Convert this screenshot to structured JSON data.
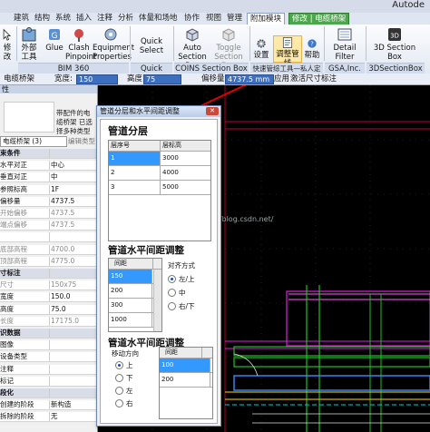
{
  "app_title": "Autode",
  "ribbon_tabs": [
    "建筑",
    "结构",
    "系统",
    "插入",
    "注释",
    "分析",
    "体量和场地",
    "协作",
    "视图",
    "管理",
    "附加模块",
    "修改 | 电缆桥架"
  ],
  "ribbon": {
    "modify": "修改",
    "external_tools": "外部工具",
    "glue": "Glue",
    "clash_pinpoint": "Clash Pinpoint",
    "equipment_properties": "Equipment Properties",
    "bim360_label": "BIM 360",
    "quick_select_1": "Quick Select",
    "quick_select_2": "Quick Select",
    "auto_section_box": "Auto Section Box",
    "toggle_section_box": "Toggle Section Box",
    "coins_label": "COINS Section Box",
    "settings": "设置",
    "pipe_adjust": "调整管线",
    "help": "帮助",
    "plugin_label": "快速管综工具—私人定制",
    "detail_filter": "Detail Filter",
    "gsa_label": "GSA,Inc.",
    "section_box_3d": "3D Section Box",
    "section_box_3d_label": "3DSectionBox"
  },
  "options_bar": {
    "tray_label": "电缆桥架",
    "width_label": "宽度:",
    "width_value": "150",
    "height_label": "高度:",
    "height_value": "75",
    "offset_label": "偏移量:",
    "offset_value": "4737.5 mm",
    "apply_label": "应用",
    "dim_label": "激活尺寸标注"
  },
  "properties": {
    "panel_title": "性",
    "type_desc": "带配件的电缆桥架 已选择多种类型",
    "type_select": "电缆桥架 (3)",
    "edit_type": "编辑类型",
    "rows": [
      {
        "k": "束条件",
        "v": "",
        "hdr": true
      },
      {
        "k": "水平对正",
        "v": "中心"
      },
      {
        "k": "垂直对正",
        "v": "中"
      },
      {
        "k": "参照标高",
        "v": "1F"
      },
      {
        "k": "偏移量",
        "v": "4737.5"
      },
      {
        "k": "开始偏移",
        "v": "4737.5",
        "dim": true
      },
      {
        "k": "端点偏移",
        "v": "4737.5",
        "dim": true
      },
      {
        "k": "",
        "v": "",
        "dim": true
      },
      {
        "k": "底部高程",
        "v": "4700.0",
        "dim": true
      },
      {
        "k": "顶部高程",
        "v": "4775.0",
        "dim": true
      },
      {
        "k": "寸标注",
        "v": "",
        "hdr": true
      },
      {
        "k": "尺寸",
        "v": "150x75",
        "dim": true
      },
      {
        "k": "宽度",
        "v": "150.0"
      },
      {
        "k": "高度",
        "v": "75.0"
      },
      {
        "k": "长度",
        "v": "17175.0",
        "dim": true
      },
      {
        "k": "识数据",
        "v": "",
        "hdr": true
      },
      {
        "k": "图像",
        "v": ""
      },
      {
        "k": "设备类型",
        "v": ""
      },
      {
        "k": "注释",
        "v": ""
      },
      {
        "k": "标记",
        "v": ""
      },
      {
        "k": "段化",
        "v": "",
        "hdr": true
      },
      {
        "k": "创建的阶段",
        "v": "新构造"
      },
      {
        "k": "拆除的阶段",
        "v": "无"
      }
    ]
  },
  "dialog": {
    "title": "管道分层和水平间距调整",
    "close": "✕",
    "sec1": "管道分层",
    "layer_headers": [
      "层序号",
      "层标高"
    ],
    "layers": [
      [
        "1",
        "3000"
      ],
      [
        "2",
        "4000"
      ],
      [
        "3",
        "5000"
      ]
    ],
    "sec2": "管道水平间距调整",
    "spacing_header": "间距",
    "spacing_values": [
      "150",
      "200",
      "300",
      "1000"
    ],
    "align_label": "对齐方式",
    "align_options": [
      "左/上",
      "中",
      "右/下"
    ],
    "sec3": "管道水平间距调整",
    "move_label": "移动方向",
    "move_options": [
      "上",
      "下",
      "左",
      "右"
    ],
    "spacing2_header": "间距",
    "spacing2_values": [
      "100",
      "200"
    ]
  },
  "watermark": "http://blog.csdn.net/"
}
